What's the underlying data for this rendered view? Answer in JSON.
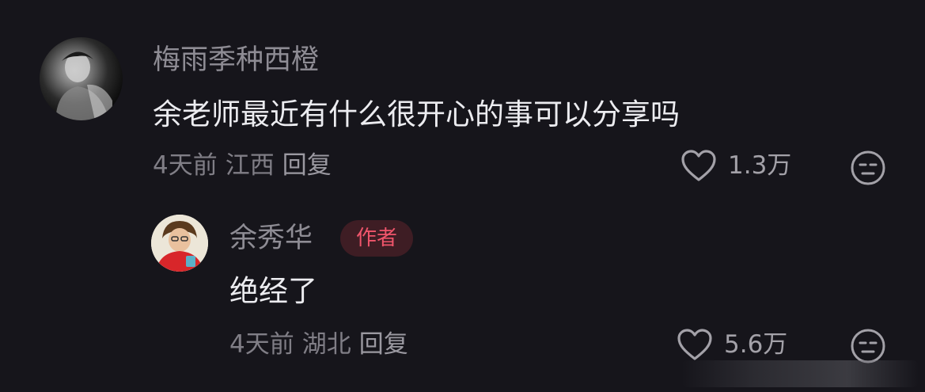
{
  "comments": [
    {
      "username": "梅雨季种西橙",
      "text": "余老师最近有什么很开心的事可以分享吗",
      "time": "4天前",
      "location": "江西",
      "reply_label": "回复",
      "likes": "1.3万"
    }
  ],
  "reply": {
    "username": "余秀华",
    "badge": "作者",
    "text": "绝经了",
    "time": "4天前",
    "location": "湖北",
    "reply_label": "回复",
    "likes": "5.6万"
  },
  "colors": {
    "background": "#16151b",
    "badge_text": "#f0556b",
    "badge_bg": "#3e1d24"
  }
}
